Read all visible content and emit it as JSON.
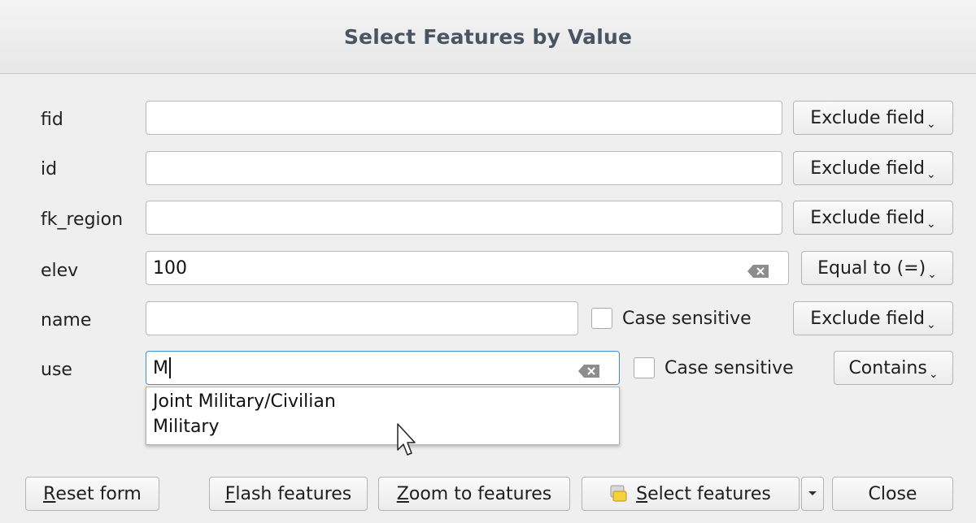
{
  "window": {
    "title": "Select Features by Value"
  },
  "fields": [
    {
      "label": "fid",
      "value": "",
      "operator": "Exclude field"
    },
    {
      "label": "id",
      "value": "",
      "operator": "Exclude field"
    },
    {
      "label": "fk_region",
      "value": "",
      "operator": "Exclude field"
    },
    {
      "label": "elev",
      "value": "100",
      "operator": "Equal to (=)"
    },
    {
      "label": "name",
      "value": "",
      "case_label": "Case sensitive",
      "operator": "Exclude field"
    },
    {
      "label": "use",
      "value": "M",
      "case_label": "Case sensitive",
      "operator": "Contains"
    }
  ],
  "autocomplete": {
    "items": [
      "Joint Military/Civilian",
      "Military"
    ]
  },
  "buttons": {
    "reset_key": "R",
    "reset_rest": "eset form",
    "flash_key": "F",
    "flash_rest": "lash features",
    "zoom_key": "Z",
    "zoom_rest": "oom to features",
    "select_key": "S",
    "select_rest": "elect features",
    "close": "Close"
  },
  "colors": {
    "focus": "#3d8fd8",
    "title": "#4a5564",
    "background": "#efefef"
  }
}
